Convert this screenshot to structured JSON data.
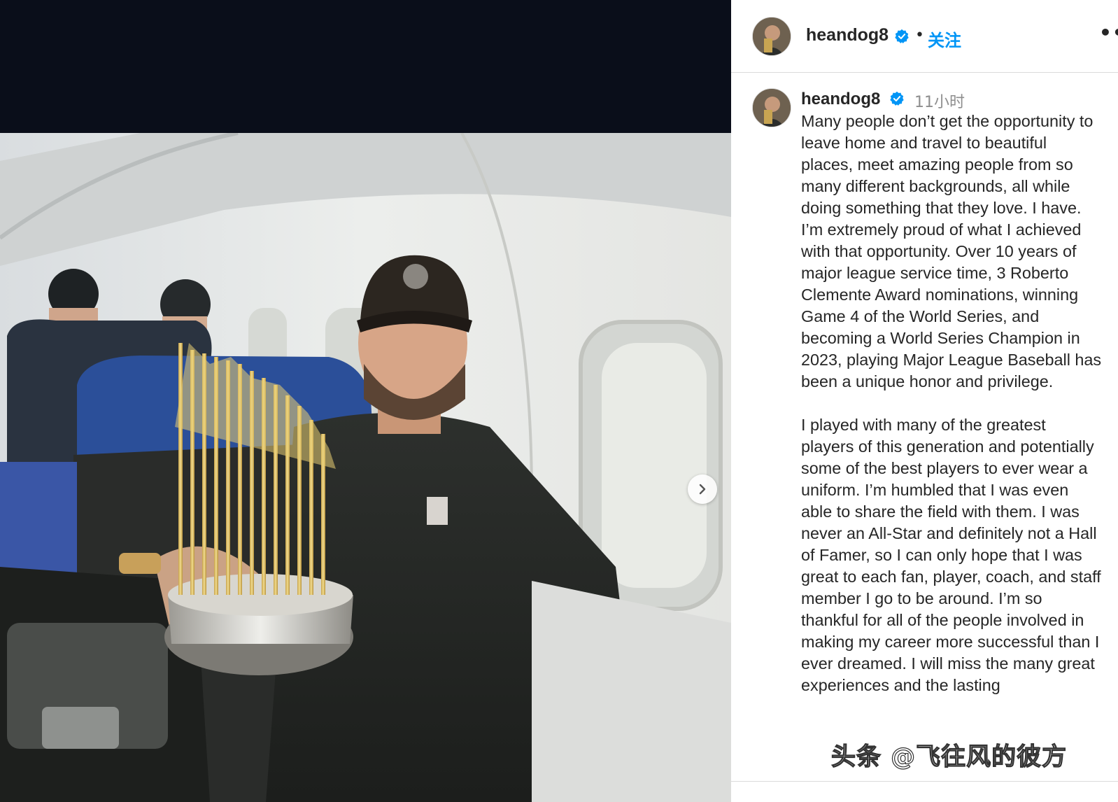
{
  "post": {
    "author": "heandog8",
    "follow_label": "关注",
    "dot": "•",
    "more_label": "•••",
    "photo_icon": "image",
    "carousel": {
      "next_icon": "chevron-right-icon"
    }
  },
  "caption": {
    "username": "heandog8",
    "time": "11小时",
    "text": "Many people don’t get the opportunity to leave home and travel to beautiful places, meet amazing people from so many different backgrounds, all while doing something that they love. I have. I’m extremely proud of what I achieved with that opportunity. Over 10 years of major league service time, 3 Roberto Clemente Award nominations, winning Game 4 of the World Series, and becoming a World Series Champion in 2023, playing Major League Baseball has been a unique honor and privilege.\n\nI played with many of the greatest players of this generation and potentially some of the best players to ever wear a uniform. I’m humbled that I was even able to share the field with them. I was never an All-Star and definitely not a Hall of Famer, so I can only hope that I was great to each fan, player, coach, and staff member I go to be around. I’m so thankful for all of the people involved in making my career more successful than I ever dreamed. I will miss the many great experiences and the lasting"
  },
  "watermark": "头条 @飞往风的彼方",
  "colors": {
    "link_blue": "#0095f6",
    "verified_blue": "#0095f6",
    "text": "#262626",
    "muted": "#8e8e8e",
    "divider": "#dbdbdb",
    "media_bg": "#0a0e1a"
  }
}
